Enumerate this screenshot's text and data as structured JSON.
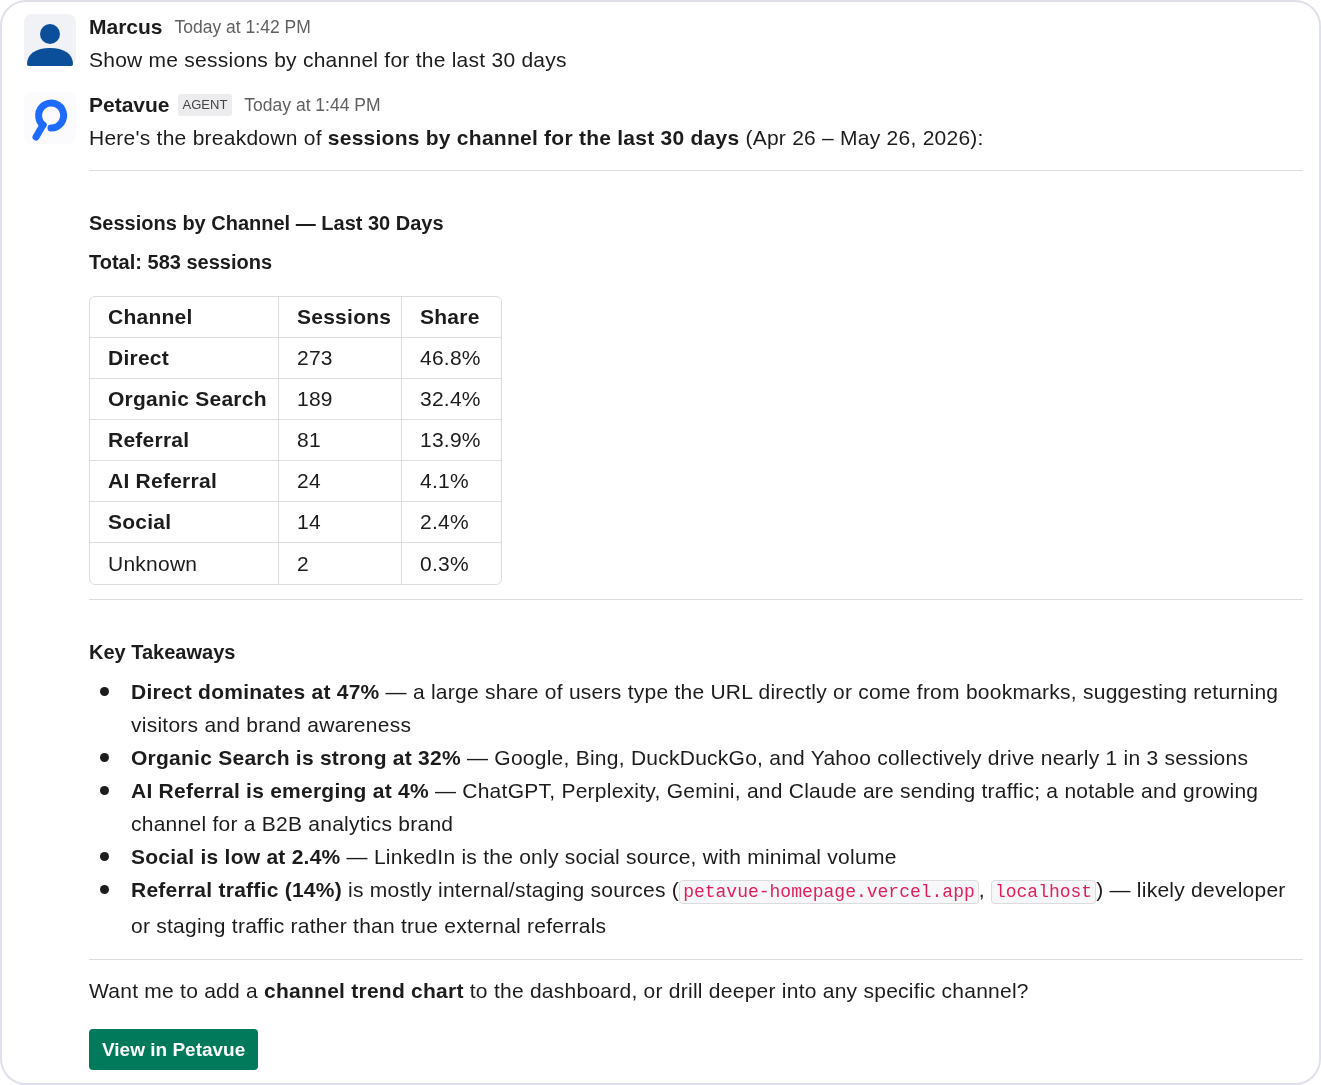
{
  "messages": [
    {
      "kind": "person",
      "author": "Marcus",
      "time": "Today at 1:42 PM",
      "text": "Show me sessions by channel for the last 30 days"
    },
    {
      "kind": "agent",
      "author": "Petavue",
      "badge": "AGENT",
      "time": "Today at 1:44 PM",
      "text": "Here's the breakdown of **sessions by channel for the last 30 days** (Apr 26 – May 26, 2026):",
      "report": {
        "title": "Sessions by Channel — Last 30 Days",
        "total": "Total: 583 sessions",
        "table": {
          "columns": [
            "Channel",
            "Sessions",
            "Share"
          ],
          "rows": [
            {
              "bold": true,
              "cells": [
                "Direct",
                "273",
                "46.8%"
              ]
            },
            {
              "bold": true,
              "cells": [
                "Organic Search",
                "189",
                "32.4%"
              ]
            },
            {
              "bold": true,
              "cells": [
                "Referral",
                "81",
                "13.9%"
              ]
            },
            {
              "bold": true,
              "cells": [
                "AI Referral",
                "24",
                "4.1%"
              ]
            },
            {
              "bold": true,
              "cells": [
                "Social",
                "14",
                "2.4%"
              ]
            },
            {
              "bold": false,
              "cells": [
                "Unknown",
                "2",
                "0.3%"
              ]
            }
          ]
        },
        "takeaways_title": "Key Takeaways",
        "takeaways": [
          {
            "parts": [
              {
                "kind": "text",
                "text": "**Direct dominates at 47%** — a large share of users type the URL directly or come from bookmarks, suggesting returning visitors and brand awareness"
              }
            ]
          },
          {
            "parts": [
              {
                "kind": "text",
                "text": "**Organic Search is strong at 32%** — Google, Bing, DuckDuckGo, and Yahoo collectively drive nearly 1 in 3 sessions"
              }
            ]
          },
          {
            "parts": [
              {
                "kind": "text",
                "text": "**AI Referral is emerging at 4%** — ChatGPT, Perplexity, Gemini, and Claude are sending traffic; a notable and growing channel for a B2B analytics brand"
              }
            ]
          },
          {
            "parts": [
              {
                "kind": "text",
                "text": "**Social is low at 2.4%** — LinkedIn is the only social source, with minimal volume"
              }
            ]
          },
          {
            "parts": [
              {
                "kind": "text",
                "text": "**Referral traffic (14%)** is mostly internal/staging sources ("
              },
              {
                "kind": "code",
                "text": "petavue-homepage.vercel.app"
              },
              {
                "kind": "text",
                "text": ", "
              },
              {
                "kind": "code",
                "text": "localhost"
              },
              {
                "kind": "text",
                "text": ") — likely developer or staging traffic rather than true external referrals"
              }
            ]
          }
        ],
        "follow_up": "Want me to add a **channel trend chart** to the dashboard, or drill deeper into any specific channel?",
        "button": "View in Petavue"
      }
    }
  ]
}
